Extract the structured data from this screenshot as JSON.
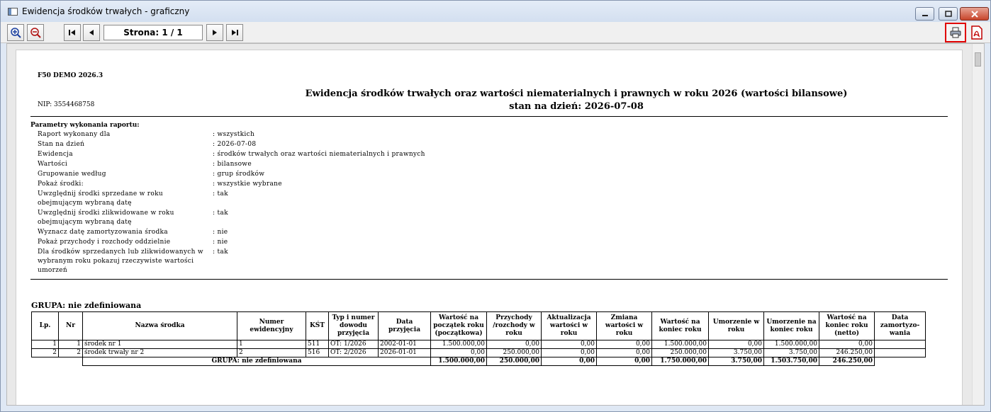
{
  "window": {
    "title": "Ewidencja środków trwałych - graficzny"
  },
  "toolbar": {
    "page_label": "Strona: 1 / 1"
  },
  "report": {
    "company": "F50 DEMO 2026.3",
    "nip": "NIP: 3554468758",
    "title_line1": "Ewidencja środków trwałych oraz wartości niematerialnych i prawnych w roku 2026 (wartości bilansowe)",
    "title_line2": "stan na dzień: 2026-07-08",
    "params_title": "Parametry wykonania raportu:",
    "params": [
      {
        "label": "Raport wykonany dla",
        "value": ": wszystkich"
      },
      {
        "label": "Stan na dzień",
        "value": ": 2026-07-08"
      },
      {
        "label": "Ewidencja",
        "value": ": środków trwałych oraz wartości niematerialnych i prawnych"
      },
      {
        "label": "Wartości",
        "value": ": bilansowe"
      },
      {
        "label": "Grupowanie według",
        "value": ": grup środków"
      },
      {
        "label": "Pokaż środki:",
        "value": ": wszystkie wybrane"
      },
      {
        "label": "Uwzględnij środki sprzedane w roku\nobejmującym wybraną datę",
        "value": ": tak"
      },
      {
        "label": "Uwzględnij środki zlikwidowane w roku\nobejmującym wybraną datę",
        "value": ": tak"
      },
      {
        "label": "Wyznacz datę zamortyzowania środka",
        "value": ": nie"
      },
      {
        "label": "Pokaż przychody i rozchody oddzielnie",
        "value": ": nie"
      },
      {
        "label": "Dla środków sprzedanych lub zlikwidowanych w\nwybranym roku pokazuj rzeczywiste wartości\numorzeń",
        "value": ": tak"
      }
    ],
    "group_title": "GRUPA:   nie zdefiniowana",
    "columns": [
      "Lp.",
      "Nr",
      "Nazwa środka",
      "Numer ewidencyjny",
      "KŚT",
      "Typ i numer dowodu przyjęcia",
      "Data przyjęcia",
      "Wartość na początek roku (początkowa)",
      "Przychody /rozchody w roku",
      "Aktualizacja wartości w roku",
      "Zmiana wartości w roku",
      "Wartość na koniec roku",
      "Umorzenie w roku",
      "Umorzenie na koniec roku",
      "Wartość na koniec roku (netto)",
      "Data zamortyzo-wania"
    ],
    "rows": [
      [
        "1",
        "1",
        "środek nr 1",
        "1",
        "511",
        "OT: 1/2026",
        "2002-01-01",
        "1.500.000,00",
        "0,00",
        "0,00",
        "0,00",
        "1.500.000,00",
        "0,00",
        "1.500.000,00",
        "0,00",
        ""
      ],
      [
        "2",
        "2",
        "środek trwały nr 2",
        "2",
        "516",
        "OT: 2/2026",
        "2026-01-01",
        "0,00",
        "250.000,00",
        "0,00",
        "0,00",
        "250.000,00",
        "3.750,00",
        "3.750,00",
        "246.250,00",
        ""
      ]
    ],
    "summary": {
      "label": "GRUPA:   nie zdefiniowana",
      "values": [
        "1.500.000,00",
        "250.000,00",
        "0,00",
        "0,00",
        "1.750.000,00",
        "3.750,00",
        "1.503.750,00",
        "246.250,00"
      ]
    }
  }
}
